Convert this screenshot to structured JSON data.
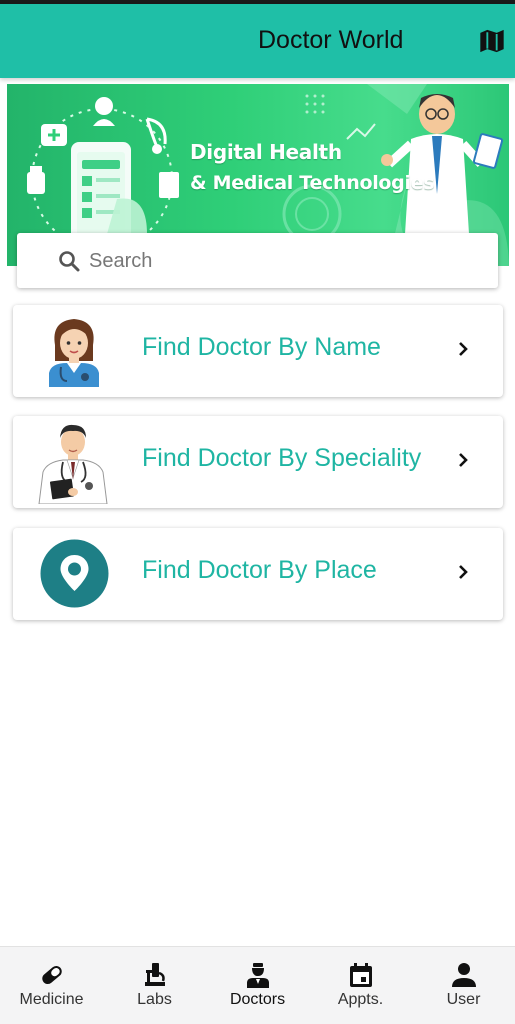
{
  "app": {
    "title": "Doctor World",
    "accent_color": "#1fbfa7",
    "action_icon": "map-icon"
  },
  "banner": {
    "line1": "Digital Health",
    "line2": "& Medical Technologies"
  },
  "search": {
    "placeholder": "Search",
    "value": "",
    "icon": "search-icon"
  },
  "options": [
    {
      "label": "Find Doctor By Name",
      "image": "female-nurse-avatar",
      "chevron": "chevron-right-icon"
    },
    {
      "label": "Find Doctor By Speciality",
      "image": "male-doctor-avatar",
      "chevron": "chevron-right-icon"
    },
    {
      "label": "Find Doctor By Place",
      "image": "location-pin-icon",
      "chevron": "chevron-right-icon"
    }
  ],
  "bottom_nav": {
    "active": "Doctors",
    "items": [
      {
        "label": "Medicine",
        "icon": "pill-icon"
      },
      {
        "label": "Labs",
        "icon": "microscope-icon"
      },
      {
        "label": "Doctors",
        "icon": "doctor-icon"
      },
      {
        "label": "Appts.",
        "icon": "calendar-icon"
      },
      {
        "label": "User",
        "icon": "user-icon"
      }
    ]
  }
}
